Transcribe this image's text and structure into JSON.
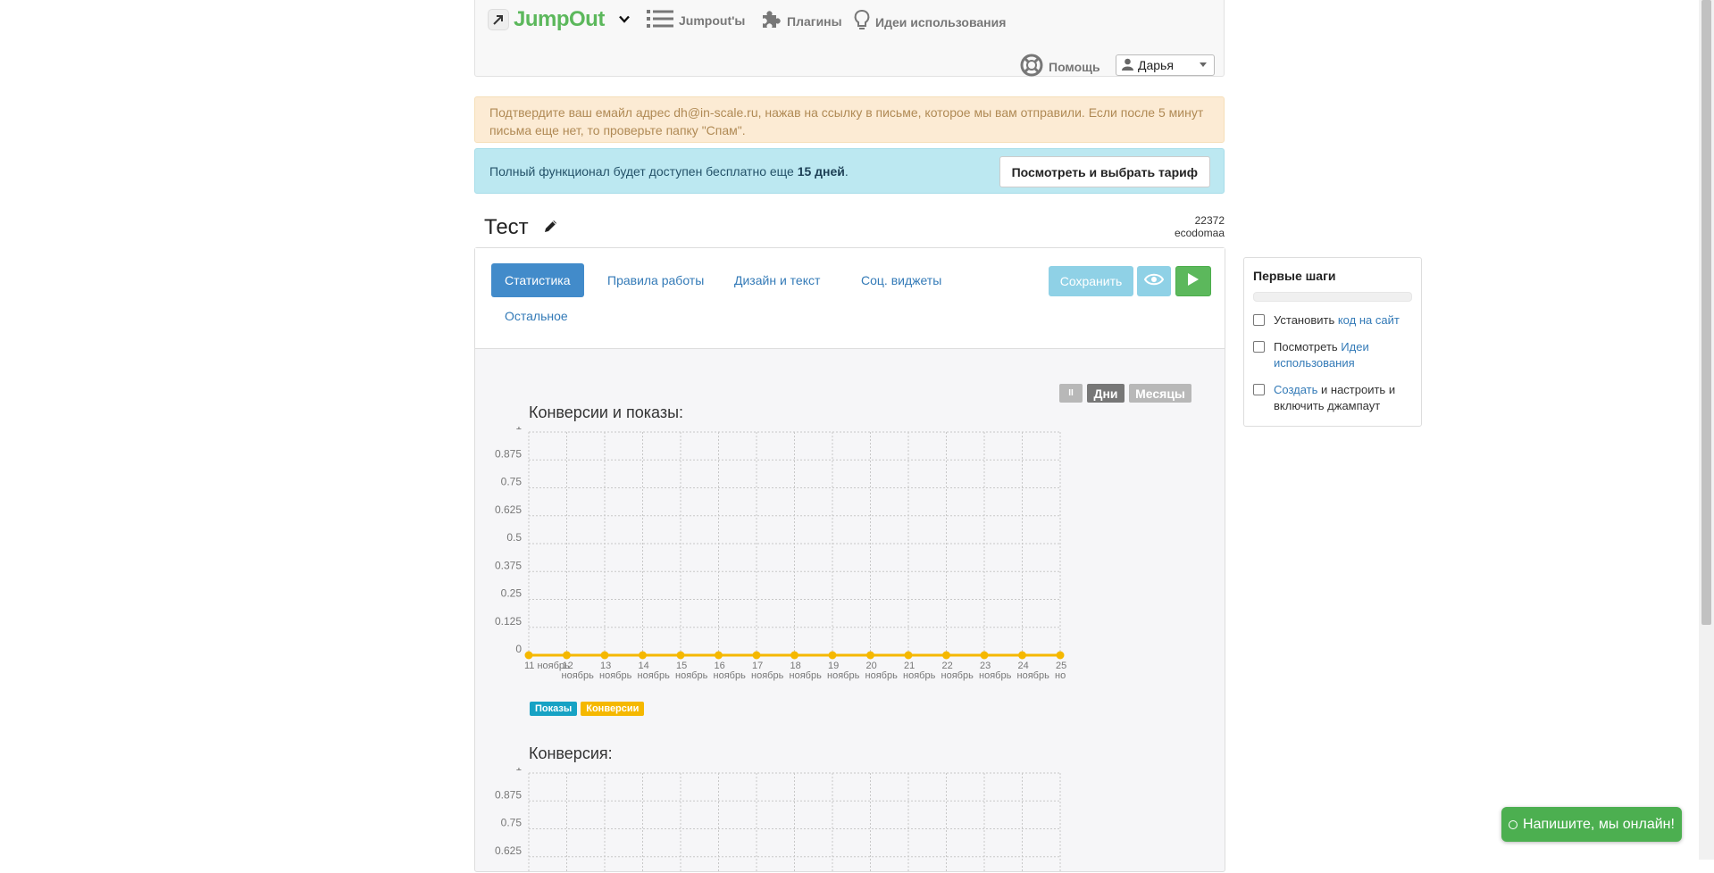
{
  "header": {
    "logo_text": "JumpOut",
    "nav": [
      {
        "label": "Jumpout'ы",
        "icon": "list-icon"
      },
      {
        "label": "Плагины",
        "icon": "puzzle-icon"
      },
      {
        "label": "Идеи использования",
        "icon": "lightbulb-icon"
      }
    ],
    "help_label": "Помощь",
    "user_name": "Дарья"
  },
  "alerts": {
    "email_text": "Подтвердите ваш емайл адрес dh@in-scale.ru, нажав на ссылку в письме, которое мы вам отправили. Если после 5 минут письма еще нет, то проверьте папку \"Спам\".",
    "trial_prefix": "Полный функционал будет доступен бесплатно еще ",
    "trial_days": "15 дней",
    "trial_suffix": ".",
    "tariff_button": "Посмотреть и выбрать тариф"
  },
  "page": {
    "title": "Тест",
    "id": "22372",
    "site": "ecodomaa"
  },
  "tabs": [
    {
      "label": "Статистика",
      "active": true
    },
    {
      "label": "Правила работы",
      "active": false
    },
    {
      "label": "Дизайн и текст",
      "active": false
    },
    {
      "label": "Соц. виджеты",
      "active": false
    },
    {
      "label": "Остальное",
      "active": false
    }
  ],
  "toolbar": {
    "save_label": "Сохранить",
    "preview_icon": "eye-icon",
    "run_icon": "play-icon"
  },
  "range": {
    "pause_label": "II",
    "days_label": "Дни",
    "months_label": "Месяцы",
    "active": "Дни"
  },
  "legend": {
    "shows_label": "Показы",
    "conversions_label": "Конверсии",
    "shows_color": "#17a2c4",
    "conversions_color": "#f5b800"
  },
  "chart_data": [
    {
      "type": "line",
      "title": "Конверсии и показы:",
      "ylim": [
        0,
        1
      ],
      "yticks": [
        "0",
        "0.125",
        "0.25",
        "0.375",
        "0.5",
        "0.625",
        "0.75",
        "0.875",
        "1"
      ],
      "categories": [
        "11 ноябрь",
        "12 ноябрь",
        "13 ноябрь",
        "14 ноябрь",
        "15 ноябрь",
        "16 ноябрь",
        "17 ноябрь",
        "18 ноябрь",
        "19 ноябрь",
        "20 ноябрь",
        "21 ноябрь",
        "22 ноябрь",
        "23 ноябрь",
        "24 ноябрь",
        "25 но"
      ],
      "grid": true,
      "legend_position": "bottom-left",
      "series": [
        {
          "name": "Показы",
          "color": "#17a2c4",
          "values": [
            0,
            0,
            0,
            0,
            0,
            0,
            0,
            0,
            0,
            0,
            0,
            0,
            0,
            0,
            0
          ]
        },
        {
          "name": "Конверсии",
          "color": "#f5b800",
          "values": [
            0,
            0,
            0,
            0,
            0,
            0,
            0,
            0,
            0,
            0,
            0,
            0,
            0,
            0,
            0
          ]
        }
      ]
    },
    {
      "type": "line",
      "title": "Конверсия:",
      "ylim": [
        0,
        1
      ],
      "yticks": [
        "0.625",
        "0.75",
        "0.875",
        "1"
      ],
      "grid": true
    }
  ],
  "first_steps": {
    "title": "Первые шаги",
    "progress": 0,
    "items": [
      {
        "before": "Установить ",
        "link": "код на сайт",
        "after": ""
      },
      {
        "before": "Посмотреть ",
        "link": "Идеи использования",
        "after": ""
      },
      {
        "before": "",
        "link": "Создать",
        "after": " и настроить и включить джампаут"
      }
    ]
  },
  "chat": {
    "label": "Напишите, мы онлайн!"
  }
}
